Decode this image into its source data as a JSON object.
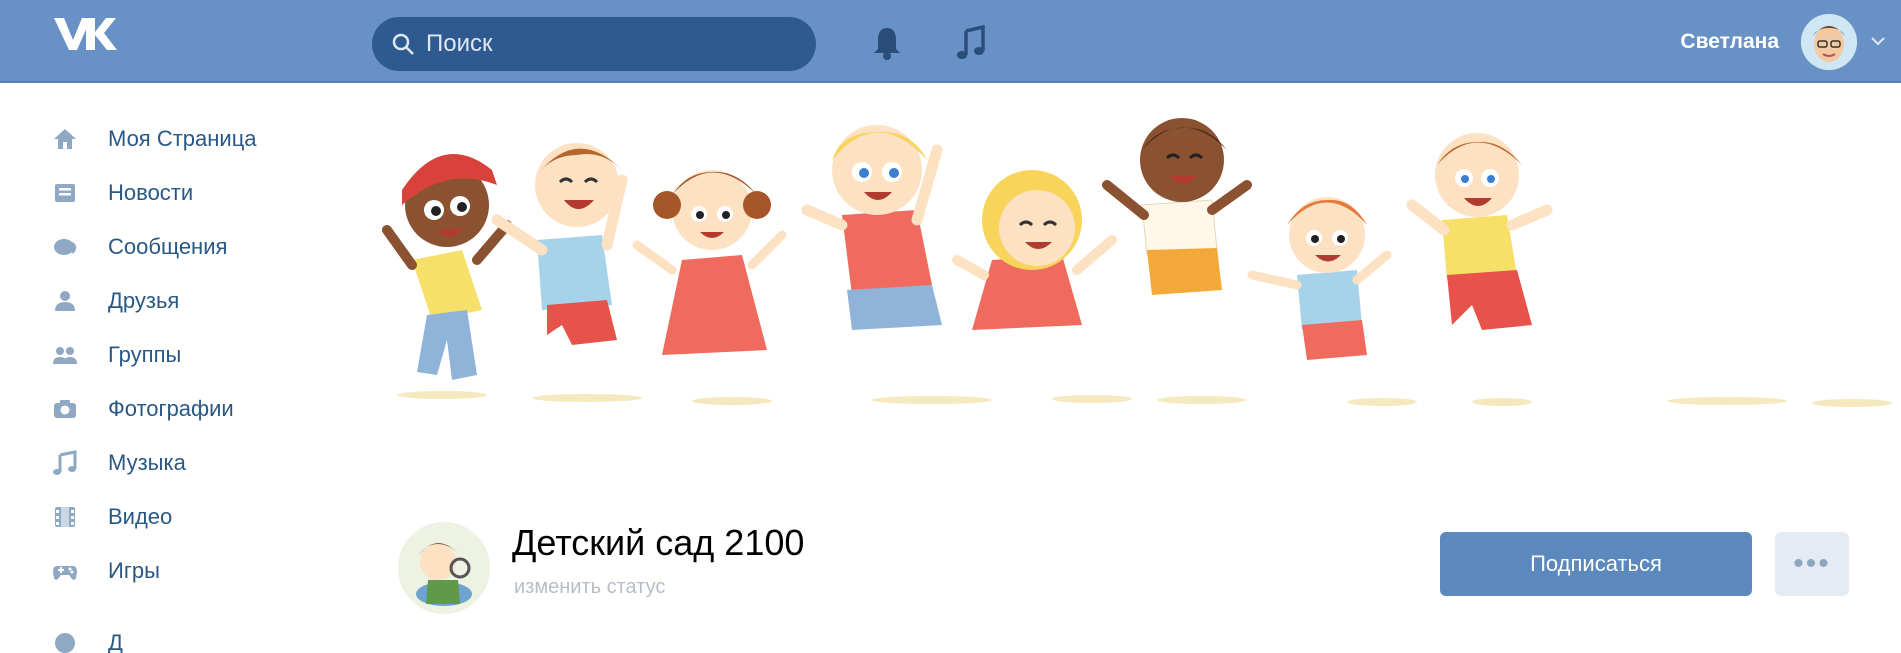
{
  "topbar": {
    "logo_icon": "vk-logo-icon",
    "search_placeholder": "Поиск",
    "user_name": "Светлана",
    "brand_color": "#6891c6"
  },
  "sidebar": {
    "items": [
      {
        "label": "Моя Страница",
        "icon": "home-icon"
      },
      {
        "label": "Новости",
        "icon": "news-icon"
      },
      {
        "label": "Сообщения",
        "icon": "messages-icon"
      },
      {
        "label": "Друзья",
        "icon": "friend-icon"
      },
      {
        "label": "Группы",
        "icon": "groups-icon"
      },
      {
        "label": "Фотографии",
        "icon": "camera-icon"
      },
      {
        "label": "Музыка",
        "icon": "music-icon"
      },
      {
        "label": "Видео",
        "icon": "video-icon"
      },
      {
        "label": "Игры",
        "icon": "gamepad-icon"
      }
    ],
    "partial_item": "Д"
  },
  "group": {
    "name": "Детский сад 2100",
    "status": "изменить статус",
    "subscribe_label": "Подписаться",
    "more_label": "•••"
  }
}
